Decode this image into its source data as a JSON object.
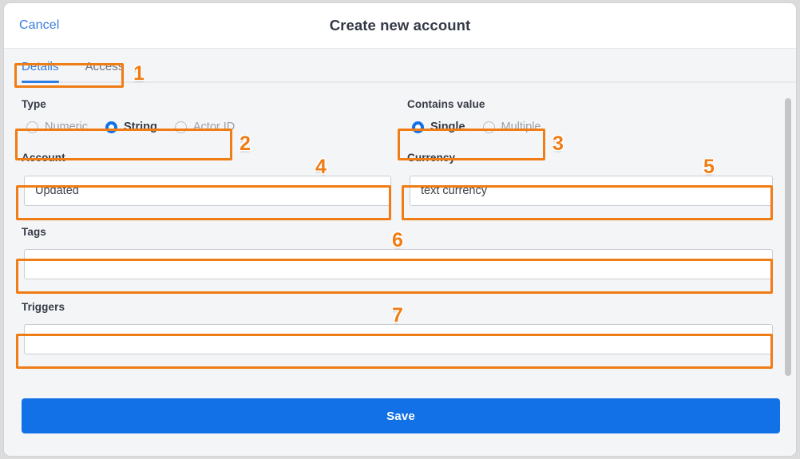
{
  "window": {
    "header": {
      "cancel_label": "Cancel",
      "title": "Create new account"
    },
    "tabs": [
      {
        "label": "Details",
        "active": true
      },
      {
        "label": "Access",
        "active": false
      }
    ],
    "form": {
      "type_group": {
        "label": "Type",
        "options": [
          {
            "label": "Numeric",
            "selected": false
          },
          {
            "label": "String",
            "selected": true
          },
          {
            "label": "Actor ID",
            "selected": false
          }
        ]
      },
      "contains_value_group": {
        "label": "Contains value",
        "options": [
          {
            "label": "Single",
            "selected": true
          },
          {
            "label": "Multiple",
            "selected": false
          }
        ]
      },
      "account_field": {
        "label": "Account",
        "value": "Updated",
        "placeholder": ""
      },
      "currency_field": {
        "label": "Currency",
        "value": "text currency",
        "placeholder": ""
      },
      "tags_field": {
        "label": "Tags",
        "value": "",
        "placeholder": ""
      },
      "triggers_field": {
        "label": "Triggers",
        "value": "",
        "placeholder": ""
      }
    },
    "footer": {
      "save_label": "Save"
    }
  },
  "annotations": {
    "color": "#f07c15",
    "markers": [
      {
        "number": "1",
        "target": "tabs"
      },
      {
        "number": "2",
        "target": "type-radio-group"
      },
      {
        "number": "3",
        "target": "contains-value-radio-group"
      },
      {
        "number": "4",
        "target": "account-input"
      },
      {
        "number": "5",
        "target": "currency-input"
      },
      {
        "number": "6",
        "target": "tags-input"
      },
      {
        "number": "7",
        "target": "triggers-input"
      }
    ]
  },
  "colors": {
    "accent_blue": "#1271e6",
    "link_blue": "#3b7ddd",
    "annotation_orange": "#f07c15",
    "body_background": "#f4f5f7",
    "text_dark": "#343a45",
    "text_muted": "#9aa0a8"
  }
}
